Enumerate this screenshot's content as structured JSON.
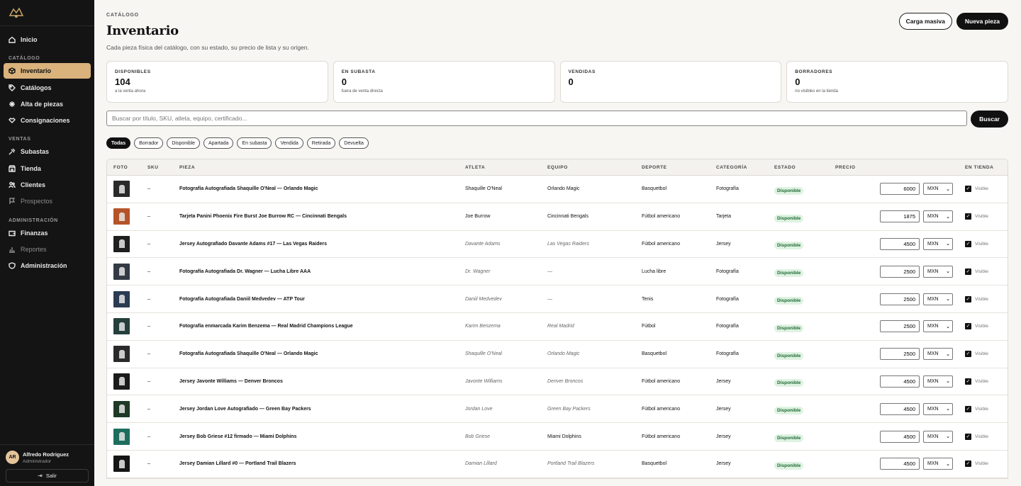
{
  "sidebar": {
    "nav": [
      {
        "label": "Inicio",
        "icon": "home-icon",
        "state": "normal"
      }
    ],
    "section_catalogo": "CATÁLOGO",
    "catalogo": [
      {
        "label": "Inventario",
        "icon": "box-icon",
        "state": "active"
      },
      {
        "label": "Catálogos",
        "icon": "tags-icon",
        "state": "normal"
      },
      {
        "label": "Alta de piezas",
        "icon": "sparkle-icon",
        "state": "normal"
      },
      {
        "label": "Consignaciones",
        "icon": "handshake-icon",
        "state": "normal"
      }
    ],
    "section_ventas": "VENTAS",
    "ventas": [
      {
        "label": "Subastas",
        "icon": "gavel-icon",
        "state": "normal"
      },
      {
        "label": "Tienda",
        "icon": "store-icon",
        "state": "normal"
      },
      {
        "label": "Clientes",
        "icon": "users-icon",
        "state": "normal"
      },
      {
        "label": "Prospectos",
        "icon": "flag-icon",
        "state": "muted"
      }
    ],
    "section_admin": "ADMINISTRACIÓN",
    "admin": [
      {
        "label": "Finanzas",
        "icon": "wallet-icon",
        "state": "normal"
      },
      {
        "label": "Reportes",
        "icon": "chart-icon",
        "state": "muted"
      },
      {
        "label": "Administración",
        "icon": "shield-icon",
        "state": "normal"
      }
    ],
    "user": {
      "initials": "AR",
      "name": "Alfredo Rodriguez",
      "role": "Administrador"
    },
    "logout_label": "Salir"
  },
  "header": {
    "eyebrow": "CATÁLOGO",
    "title": "Inventario",
    "subtitle": "Cada pieza física del catálogo, con su estado, su precio de lista y su origen.",
    "bulk_label": "Carga masiva",
    "new_label": "Nueva pieza"
  },
  "stats": [
    {
      "label": "DISPONIBLES",
      "value": "104",
      "hint": "a la venta ahora"
    },
    {
      "label": "EN SUBASTA",
      "value": "0",
      "hint": "fuera de venta directa"
    },
    {
      "label": "VENDIDAS",
      "value": "0",
      "hint": ""
    },
    {
      "label": "BORRADORES",
      "value": "0",
      "hint": "no visibles en la tienda"
    }
  ],
  "search": {
    "placeholder": "Buscar por título, SKU, atleta, equipo, certificado...",
    "button_label": "Buscar"
  },
  "filters": [
    "Todas",
    "Borrador",
    "Disponible",
    "Apartada",
    "En subasta",
    "Vendida",
    "Retirada",
    "Devuelta"
  ],
  "table": {
    "headers": {
      "foto": "FOTO",
      "sku": "SKU",
      "pieza": "PIEZA",
      "atleta": "ATLETA",
      "equipo": "EQUIPO",
      "deporte": "DEPORTE",
      "categoria": "CATEGORÍA",
      "estado": "ESTADO",
      "precio": "PRECIO",
      "tienda": "EN TIENDA"
    },
    "rows": [
      {
        "sku": "–",
        "pieza": "Fotografía Autografiada Shaquille O'Neal — Orlando Magic",
        "atleta": "Shaquille O'Neal",
        "atleta_italic": false,
        "equipo": "Orlando Magic",
        "equipo_italic": false,
        "deporte": "Basquetbol",
        "categoria": "Fotografía",
        "estado": "Disponible",
        "precio": "6000",
        "moneda": "MXN",
        "tienda": "Visible",
        "thumb": "#2a2a2a"
      },
      {
        "sku": "–",
        "pieza": "Tarjeta Panini Phoenix Fire Burst Joe Burrow RC — Cincinnati Bengals",
        "atleta": "Joe Burrow",
        "atleta_italic": false,
        "equipo": "Cincinnati Bengals",
        "equipo_italic": false,
        "deporte": "Fútbol americano",
        "categoria": "Tarjeta",
        "estado": "Disponible",
        "precio": "1875",
        "moneda": "MXN",
        "tienda": "Visible",
        "thumb": "#b5542a"
      },
      {
        "sku": "–",
        "pieza": "Jersey Autografiado Davante Adams #17 — Las Vegas Raiders",
        "atleta": "Davante Adams",
        "atleta_italic": true,
        "equipo": "Las Vegas Raiders",
        "equipo_italic": true,
        "deporte": "Fútbol americano",
        "categoria": "Jersey",
        "estado": "Disponible",
        "precio": "4500",
        "moneda": "MXN",
        "tienda": "Visible",
        "thumb": "#1f1f1f"
      },
      {
        "sku": "–",
        "pieza": "Fotografía Autografiada Dr. Wagner — Lucha Libre AAA",
        "atleta": "Dr. Wagner",
        "atleta_italic": true,
        "equipo": "—",
        "equipo_italic": true,
        "deporte": "Lucha libre",
        "categoria": "Fotografía",
        "estado": "Disponible",
        "precio": "2500",
        "moneda": "MXN",
        "tienda": "Visible",
        "thumb": "#333a44"
      },
      {
        "sku": "–",
        "pieza": "Fotografía Autografiada Daniil Medvedev — ATP Tour",
        "atleta": "Daniil Medvedev",
        "atleta_italic": true,
        "equipo": "—",
        "equipo_italic": true,
        "deporte": "Tenis",
        "categoria": "Fotografía",
        "estado": "Disponible",
        "precio": "2500",
        "moneda": "MXN",
        "tienda": "Visible",
        "thumb": "#2b3b52"
      },
      {
        "sku": "–",
        "pieza": "Fotografía enmarcada Karim Benzema — Real Madrid Champions League",
        "atleta": "Karim Benzema",
        "atleta_italic": true,
        "equipo": "Real Madrid",
        "equipo_italic": true,
        "deporte": "Fútbol",
        "categoria": "Fotografía",
        "estado": "Disponible",
        "precio": "2500",
        "moneda": "MXN",
        "tienda": "Visible",
        "thumb": "#25403a"
      },
      {
        "sku": "–",
        "pieza": "Fotografía Autografiada Shaquille O'Neal — Orlando Magic",
        "atleta": "Shaquille O'Neal",
        "atleta_italic": true,
        "equipo": "Orlando Magic",
        "equipo_italic": true,
        "deporte": "Basquetbol",
        "categoria": "Fotografía",
        "estado": "Disponible",
        "precio": "2500",
        "moneda": "MXN",
        "tienda": "Visible",
        "thumb": "#2a2a2a"
      },
      {
        "sku": "–",
        "pieza": "Jersey Javonte Williams — Denver Broncos",
        "atleta": "Javonte Williams",
        "atleta_italic": true,
        "equipo": "Denver Broncos",
        "equipo_italic": true,
        "deporte": "Fútbol americano",
        "categoria": "Jersey",
        "estado": "Disponible",
        "precio": "4500",
        "moneda": "MXN",
        "tienda": "Visible",
        "thumb": "#1b1b1b"
      },
      {
        "sku": "–",
        "pieza": "Jersey Jordan Love Autografiado — Green Bay Packers",
        "atleta": "Jordan Love",
        "atleta_italic": true,
        "equipo": "Green Bay Packers",
        "equipo_italic": true,
        "deporte": "Fútbol americano",
        "categoria": "Jersey",
        "estado": "Disponible",
        "precio": "4500",
        "moneda": "MXN",
        "tienda": "Visible",
        "thumb": "#1e3a26"
      },
      {
        "sku": "–",
        "pieza": "Jersey Bob Griese #12 firmado — Miami Dolphins",
        "atleta": "Bob Griese",
        "atleta_italic": true,
        "equipo": "Miami Dolphins",
        "equipo_italic": false,
        "deporte": "Fútbol americano",
        "categoria": "Jersey",
        "estado": "Disponible",
        "precio": "4500",
        "moneda": "MXN",
        "tienda": "Visible",
        "thumb": "#1e6e5e"
      },
      {
        "sku": "–",
        "pieza": "Jersey Damian Lillard #0 — Portland Trail Blazers",
        "atleta": "Damian Lillard",
        "atleta_italic": true,
        "equipo": "Portland Trail Blazers",
        "equipo_italic": true,
        "deporte": "Basquetbol",
        "categoria": "Jersey",
        "estado": "Disponible",
        "precio": "4500",
        "moneda": "MXN",
        "tienda": "Visible",
        "thumb": "#151515"
      }
    ]
  }
}
